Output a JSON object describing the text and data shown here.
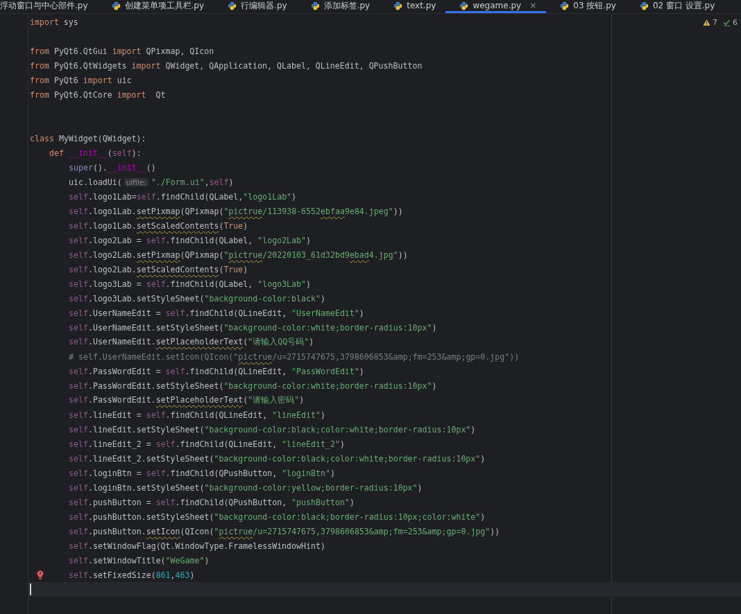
{
  "tabs": [
    {
      "label": "浮动窗口与中心部件.py",
      "selected": false,
      "has_icon": false
    },
    {
      "label": "创建菜单项工具栏.py",
      "selected": false,
      "has_icon": true
    },
    {
      "label": "行编辑器.py",
      "selected": false,
      "has_icon": true
    },
    {
      "label": "添加标签.py",
      "selected": false,
      "has_icon": true
    },
    {
      "label": "text.py",
      "selected": false,
      "has_icon": true
    },
    {
      "label": "wegame.py",
      "selected": true,
      "has_icon": true,
      "close": "×"
    },
    {
      "label": "03 按钮.py",
      "selected": false,
      "has_icon": true
    },
    {
      "label": "02 窗口 设置.py",
      "selected": false,
      "has_icon": true
    }
  ],
  "inspections": {
    "warnings": "7",
    "passed": "6"
  },
  "lines": [
    {
      "kind": "top",
      "t": [
        {
          "kind": "kw",
          "s": "import"
        },
        {
          "kind": "tx",
          "s": " sys"
        }
      ]
    },
    {
      "kind": "top"
    },
    {
      "kind": "top",
      "t": [
        {
          "kind": "kw",
          "s": "from"
        },
        {
          "kind": "tx",
          "s": " PyQt6.QtGui "
        },
        {
          "kind": "kw",
          "s": "import"
        },
        {
          "kind": "tx",
          "s": " QPixmap, QIcon"
        }
      ]
    },
    {
      "kind": "top",
      "t": [
        {
          "kind": "kw",
          "s": "from"
        },
        {
          "kind": "tx",
          "s": " PyQt6.QtWidgets "
        },
        {
          "kind": "kw",
          "s": "import"
        },
        {
          "kind": "tx",
          "s": " QWidget, QApplication, QLabel, QLineEdit, QPushButton"
        }
      ]
    },
    {
      "kind": "top",
      "t": [
        {
          "kind": "kw",
          "s": "from"
        },
        {
          "kind": "tx",
          "s": " PyQt6 "
        },
        {
          "kind": "kw",
          "s": "import"
        },
        {
          "kind": "tx",
          "s": " uic"
        }
      ]
    },
    {
      "kind": "top",
      "t": [
        {
          "kind": "kw",
          "s": "from"
        },
        {
          "kind": "tx",
          "s": " PyQt6.QtCore "
        },
        {
          "kind": "kw",
          "s": "import"
        },
        {
          "kind": "tx",
          "s": "  Qt"
        }
      ]
    },
    {
      "kind": "top"
    },
    {
      "kind": "top"
    },
    {
      "kind": "top",
      "t": [
        {
          "kind": "kw",
          "s": "class"
        },
        {
          "kind": "tx",
          "s": " MyWidget(QWidget):"
        }
      ]
    },
    {
      "kind": "method",
      "t": [
        {
          "kind": "kw",
          "s": "def "
        },
        {
          "kind": "mg",
          "s": "__init__"
        },
        {
          "kind": "tx",
          "s": "("
        },
        {
          "kind": "sf",
          "s": "self"
        },
        {
          "kind": "tx",
          "s": "):"
        }
      ]
    },
    {
      "kind": "body",
      "t": [
        {
          "kind": "bi",
          "s": "super"
        },
        {
          "kind": "tx",
          "s": "()."
        },
        {
          "kind": "mg",
          "s": "__init__"
        },
        {
          "kind": "tx",
          "s": "()"
        }
      ]
    },
    {
      "kind": "body",
      "t": [
        {
          "kind": "tx",
          "s": "uic.loadUi("
        },
        {
          "kind": "hint",
          "s": "uifile:"
        },
        {
          "kind": "st",
          "s": "\"./Form.ui\""
        },
        {
          "kind": "tx",
          "s": ","
        },
        {
          "kind": "sf",
          "s": "self"
        },
        {
          "kind": "tx",
          "s": ")"
        }
      ]
    },
    {
      "kind": "body",
      "t": [
        {
          "kind": "sf",
          "s": "self"
        },
        {
          "kind": "tx",
          "s": ".logo1Lab="
        },
        {
          "kind": "sf",
          "s": "self"
        },
        {
          "kind": "tx",
          "s": ".findChild(QLabel,"
        },
        {
          "kind": "st",
          "s": "\"logo1Lab\""
        },
        {
          "kind": "tx",
          "s": ")"
        }
      ]
    },
    {
      "kind": "body",
      "t": [
        {
          "kind": "sf",
          "s": "self"
        },
        {
          "kind": "tx",
          "s": ".logo1Lab."
        },
        {
          "kind": "fnty",
          "s": "setPixmap"
        },
        {
          "kind": "tx",
          "s": "(QPixmap("
        },
        {
          "kind": "st",
          "s": "\""
        },
        {
          "kind": "sty",
          "s": "pictrue"
        },
        {
          "kind": "st",
          "s": "/113938-6552"
        },
        {
          "kind": "sty",
          "s": "ebfaa"
        },
        {
          "kind": "st",
          "s": "9e84.jpeg\""
        },
        {
          "kind": "tx",
          "s": "))"
        }
      ]
    },
    {
      "kind": "body",
      "t": [
        {
          "kind": "sf",
          "s": "self"
        },
        {
          "kind": "tx",
          "s": ".logo1Lab."
        },
        {
          "kind": "fnty",
          "s": "setScaledContents"
        },
        {
          "kind": "tx",
          "s": "("
        },
        {
          "kind": "kw",
          "s": "True"
        },
        {
          "kind": "tx",
          "s": ")"
        }
      ]
    },
    {
      "kind": "body",
      "t": [
        {
          "kind": "sf",
          "s": "self"
        },
        {
          "kind": "tx",
          "s": ".logo2Lab = "
        },
        {
          "kind": "sf",
          "s": "self"
        },
        {
          "kind": "tx",
          "s": ".findChild(QLabel, "
        },
        {
          "kind": "st",
          "s": "\"logo2Lab\""
        },
        {
          "kind": "tx",
          "s": ")"
        }
      ]
    },
    {
      "kind": "body",
      "t": [
        {
          "kind": "sf",
          "s": "self"
        },
        {
          "kind": "tx",
          "s": ".logo2Lab."
        },
        {
          "kind": "fnty",
          "s": "setPixmap"
        },
        {
          "kind": "tx",
          "s": "(QPixmap("
        },
        {
          "kind": "st",
          "s": "\""
        },
        {
          "kind": "sty",
          "s": "pictrue"
        },
        {
          "kind": "st",
          "s": "/20220103_61d32bd9"
        },
        {
          "kind": "sty",
          "s": "ebad"
        },
        {
          "kind": "st",
          "s": "4.jpg\""
        },
        {
          "kind": "tx",
          "s": "))"
        }
      ]
    },
    {
      "kind": "body",
      "t": [
        {
          "kind": "sf",
          "s": "self"
        },
        {
          "kind": "tx",
          "s": ".logo2Lab."
        },
        {
          "kind": "fnty",
          "s": "setScaledContents"
        },
        {
          "kind": "tx",
          "s": "("
        },
        {
          "kind": "kw",
          "s": "True"
        },
        {
          "kind": "tx",
          "s": ")"
        }
      ]
    },
    {
      "kind": "body",
      "t": [
        {
          "kind": "sf",
          "s": "self"
        },
        {
          "kind": "tx",
          "s": ".logo3Lab = "
        },
        {
          "kind": "sf",
          "s": "self"
        },
        {
          "kind": "tx",
          "s": ".findChild(QLabel, "
        },
        {
          "kind": "st",
          "s": "\"logo3Lab\""
        },
        {
          "kind": "tx",
          "s": ")"
        }
      ]
    },
    {
      "kind": "body",
      "t": [
        {
          "kind": "sf",
          "s": "self"
        },
        {
          "kind": "tx",
          "s": ".logo3Lab.setStyleSheet("
        },
        {
          "kind": "st",
          "s": "\"background-color:black\""
        },
        {
          "kind": "tx",
          "s": ")"
        }
      ]
    },
    {
      "kind": "body",
      "t": [
        {
          "kind": "sf",
          "s": "self"
        },
        {
          "kind": "tx",
          "s": ".UserNameEdit = "
        },
        {
          "kind": "sf",
          "s": "self"
        },
        {
          "kind": "tx",
          "s": ".findChild(QLineEdit, "
        },
        {
          "kind": "st",
          "s": "\"UserNameEdit\""
        },
        {
          "kind": "tx",
          "s": ")"
        }
      ]
    },
    {
      "kind": "body",
      "t": [
        {
          "kind": "sf",
          "s": "self"
        },
        {
          "kind": "tx",
          "s": ".UserNameEdit.setStyleSheet("
        },
        {
          "kind": "st",
          "s": "\"background-color:white;border-radius:10px\""
        },
        {
          "kind": "tx",
          "s": ")"
        }
      ]
    },
    {
      "kind": "body",
      "t": [
        {
          "kind": "sf",
          "s": "self"
        },
        {
          "kind": "tx",
          "s": ".UserNameEdit."
        },
        {
          "kind": "fnty",
          "s": "setPlaceholderText"
        },
        {
          "kind": "tx",
          "s": "("
        },
        {
          "kind": "st",
          "s": "\"请输入QQ号码\""
        },
        {
          "kind": "tx",
          "s": ")"
        }
      ]
    },
    {
      "kind": "body",
      "t": [
        {
          "kind": "cm",
          "s": "# self.UserNameEdit.setIcon(QIcon(\""
        },
        {
          "kind": "cmty",
          "s": "pictrue"
        },
        {
          "kind": "cm",
          "s": "/u=2715747675,3798606853&amp;fm=253&amp;gp=0.jpg\"))"
        }
      ]
    },
    {
      "kind": "body",
      "t": [
        {
          "kind": "sf",
          "s": "self"
        },
        {
          "kind": "tx",
          "s": ".PassWordEdit = "
        },
        {
          "kind": "sf",
          "s": "self"
        },
        {
          "kind": "tx",
          "s": ".findChild(QLineEdit, "
        },
        {
          "kind": "st",
          "s": "\"PassWordEdit\""
        },
        {
          "kind": "tx",
          "s": ")"
        }
      ]
    },
    {
      "kind": "body",
      "t": [
        {
          "kind": "sf",
          "s": "self"
        },
        {
          "kind": "tx",
          "s": ".PassWordEdit.setStyleSheet("
        },
        {
          "kind": "st",
          "s": "\"background-color:white;border-radius:10px\""
        },
        {
          "kind": "tx",
          "s": ")"
        }
      ]
    },
    {
      "kind": "body",
      "t": [
        {
          "kind": "sf",
          "s": "self"
        },
        {
          "kind": "tx",
          "s": ".PassWordEdit."
        },
        {
          "kind": "fnty",
          "s": "setPlaceholderText"
        },
        {
          "kind": "tx",
          "s": "("
        },
        {
          "kind": "st",
          "s": "\"请输入密码\""
        },
        {
          "kind": "tx",
          "s": ")"
        }
      ]
    },
    {
      "kind": "body",
      "t": [
        {
          "kind": "sf",
          "s": "self"
        },
        {
          "kind": "tx",
          "s": ".lineEdit = "
        },
        {
          "kind": "sf",
          "s": "self"
        },
        {
          "kind": "tx",
          "s": ".findChild(QLineEdit, "
        },
        {
          "kind": "st",
          "s": "\"lineEdit\""
        },
        {
          "kind": "tx",
          "s": ")"
        }
      ]
    },
    {
      "kind": "body",
      "t": [
        {
          "kind": "sf",
          "s": "self"
        },
        {
          "kind": "tx",
          "s": ".lineEdit.setStyleSheet("
        },
        {
          "kind": "st",
          "s": "\"background-color:black;color:white;border-radius:10px\""
        },
        {
          "kind": "tx",
          "s": ")"
        }
      ]
    },
    {
      "kind": "body",
      "t": [
        {
          "kind": "sf",
          "s": "self"
        },
        {
          "kind": "tx",
          "s": ".lineEdit_2 = "
        },
        {
          "kind": "sf",
          "s": "self"
        },
        {
          "kind": "tx",
          "s": ".findChild(QLineEdit, "
        },
        {
          "kind": "st",
          "s": "\"lineEdit_2\""
        },
        {
          "kind": "tx",
          "s": ")"
        }
      ]
    },
    {
      "kind": "body",
      "t": [
        {
          "kind": "sf",
          "s": "self"
        },
        {
          "kind": "tx",
          "s": ".lineEdit_2.setStyleSheet("
        },
        {
          "kind": "st",
          "s": "\"background-color:black;color:white;border-radius:10px\""
        },
        {
          "kind": "tx",
          "s": ")"
        }
      ]
    },
    {
      "kind": "body",
      "t": [
        {
          "kind": "sf",
          "s": "self"
        },
        {
          "kind": "tx",
          "s": ".loginBtn = "
        },
        {
          "kind": "sf",
          "s": "self"
        },
        {
          "kind": "tx",
          "s": ".findChild(QPushButton, "
        },
        {
          "kind": "st",
          "s": "\"loginBtn\""
        },
        {
          "kind": "tx",
          "s": ")"
        }
      ]
    },
    {
      "kind": "body",
      "t": [
        {
          "kind": "sf",
          "s": "self"
        },
        {
          "kind": "tx",
          "s": ".loginBtn.setStyleSheet("
        },
        {
          "kind": "st",
          "s": "\"background-color:yellow;border-radius:10px\""
        },
        {
          "kind": "tx",
          "s": ")"
        }
      ]
    },
    {
      "kind": "body",
      "t": [
        {
          "kind": "sf",
          "s": "self"
        },
        {
          "kind": "tx",
          "s": ".pushButton = "
        },
        {
          "kind": "sf",
          "s": "self"
        },
        {
          "kind": "tx",
          "s": ".findChild(QPushButton, "
        },
        {
          "kind": "st",
          "s": "\"pushButton\""
        },
        {
          "kind": "tx",
          "s": ")"
        }
      ]
    },
    {
      "kind": "body",
      "t": [
        {
          "kind": "sf",
          "s": "self"
        },
        {
          "kind": "tx",
          "s": ".pushButton.setStyleSheet("
        },
        {
          "kind": "st",
          "s": "\"background-color:black;border-radius:10px;color:white\""
        },
        {
          "kind": "tx",
          "s": ")"
        }
      ]
    },
    {
      "kind": "body",
      "t": [
        {
          "kind": "sf",
          "s": "self"
        },
        {
          "kind": "tx",
          "s": ".pushButton."
        },
        {
          "kind": "fnty",
          "s": "setIcon"
        },
        {
          "kind": "tx",
          "s": "(QIcon("
        },
        {
          "kind": "st",
          "s": "\""
        },
        {
          "kind": "sty",
          "s": "pictrue"
        },
        {
          "kind": "st",
          "s": "/u=2715747675,3798606853&amp;fm=253&amp;gp=0.jpg\""
        },
        {
          "kind": "tx",
          "s": "))"
        }
      ]
    },
    {
      "kind": "body",
      "t": [
        {
          "kind": "sf",
          "s": "self"
        },
        {
          "kind": "tx",
          "s": ".setWindowFlag(Qt.WindowType.FramelessWindowHint)"
        }
      ]
    },
    {
      "kind": "body",
      "t": [
        {
          "kind": "sf",
          "s": "self"
        },
        {
          "kind": "tx",
          "s": ".setWindowTitle("
        },
        {
          "kind": "st",
          "s": "\"WeGame\""
        },
        {
          "kind": "tx",
          "s": ")"
        }
      ]
    },
    {
      "kind": "error",
      "t": [
        {
          "kind": "sf",
          "s": "self"
        },
        {
          "kind": "tx",
          "s": ".setFixedSize("
        },
        {
          "kind": "nu",
          "s": "861"
        },
        {
          "kind": "tx",
          "s": ","
        },
        {
          "kind": "nu",
          "s": "463"
        },
        {
          "kind": "tx",
          "s": ")"
        }
      ]
    },
    {
      "kind": "current"
    }
  ]
}
